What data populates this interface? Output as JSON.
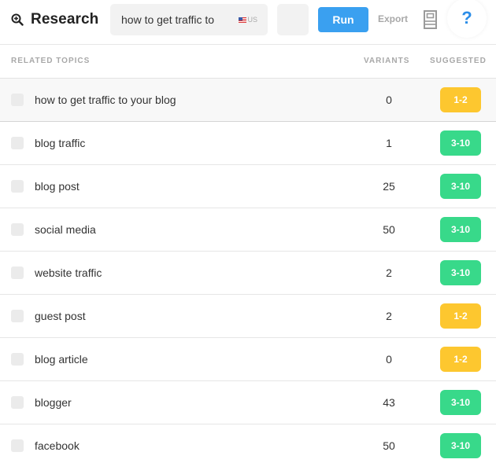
{
  "header": {
    "title": "Research",
    "title_icon": "zoom-in-magnifier-icon",
    "search": {
      "value": "how to get traffic to",
      "locale": "US",
      "locale_icon": "us-flag-icon"
    },
    "run_label": "Run",
    "export_label": "Export",
    "doc_icon": "document-icon",
    "help_label": "?"
  },
  "table": {
    "columns": [
      "RELATED TOPICS",
      "VARIANTS",
      "SUGGESTED"
    ],
    "rows": [
      {
        "topic": "how to get traffic to your blog",
        "variants": "0",
        "suggested": "1-2",
        "level": "low"
      },
      {
        "topic": "blog traffic",
        "variants": "1",
        "suggested": "3-10",
        "level": "high"
      },
      {
        "topic": "blog post",
        "variants": "25",
        "suggested": "3-10",
        "level": "high"
      },
      {
        "topic": "social media",
        "variants": "50",
        "suggested": "3-10",
        "level": "high"
      },
      {
        "topic": "website traffic",
        "variants": "2",
        "suggested": "3-10",
        "level": "high"
      },
      {
        "topic": "guest post",
        "variants": "2",
        "suggested": "1-2",
        "level": "low"
      },
      {
        "topic": "blog article",
        "variants": "0",
        "suggested": "1-2",
        "level": "low"
      },
      {
        "topic": "blogger",
        "variants": "43",
        "suggested": "3-10",
        "level": "high"
      },
      {
        "topic": "facebook",
        "variants": "50",
        "suggested": "3-10",
        "level": "high"
      }
    ]
  },
  "colors": {
    "accent": "#3aa0f0",
    "help": "#2b8de8",
    "badge_low": "#fdc72f",
    "badge_high": "#38d98a"
  }
}
